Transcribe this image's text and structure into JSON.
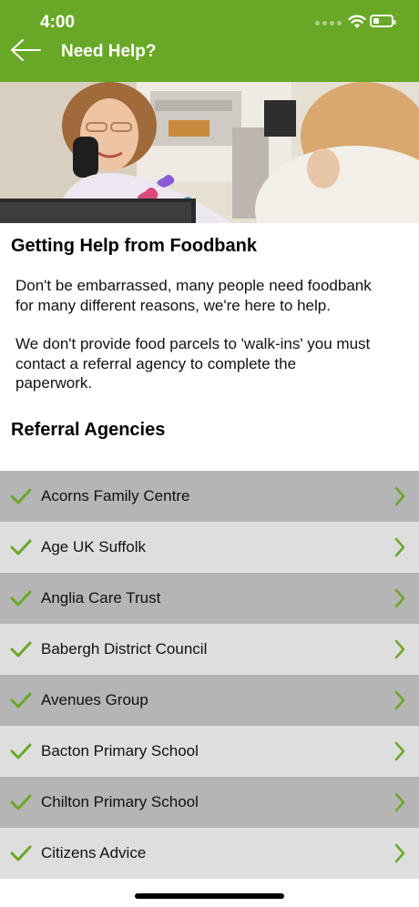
{
  "status_bar": {
    "time": "4:00",
    "battery_level": 0.35
  },
  "nav": {
    "title": "Need Help?",
    "back_icon": "arrow-left-icon"
  },
  "hero_image": {
    "icon": "photo-receptionist-on-phone"
  },
  "content": {
    "heading": "Getting Help from Foodbank",
    "paragraph1_line1": "Don't be embarrassed, many people need foodbank",
    "paragraph1_line2": "for many different reasons, we're here to help.",
    "paragraph2_line1": "We don't provide food parcels to 'walk-ins' you must",
    "paragraph2_line2": "contact a referral agency to complete the",
    "paragraph2_line3": "paperwork.",
    "section_title": "Referral Agencies"
  },
  "agencies": [
    {
      "label": "Acorns Family Centre"
    },
    {
      "label": "Age UK Suffolk"
    },
    {
      "label": "Anglia Care Trust"
    },
    {
      "label": "Babergh District Council"
    },
    {
      "label": "Avenues Group"
    },
    {
      "label": "Bacton Primary School"
    },
    {
      "label": "Chilton Primary School"
    },
    {
      "label": "Citizens Advice"
    }
  ],
  "colors": {
    "accent": "#69a826",
    "row_dark": "#b5b5b5",
    "row_light": "#dedede"
  }
}
